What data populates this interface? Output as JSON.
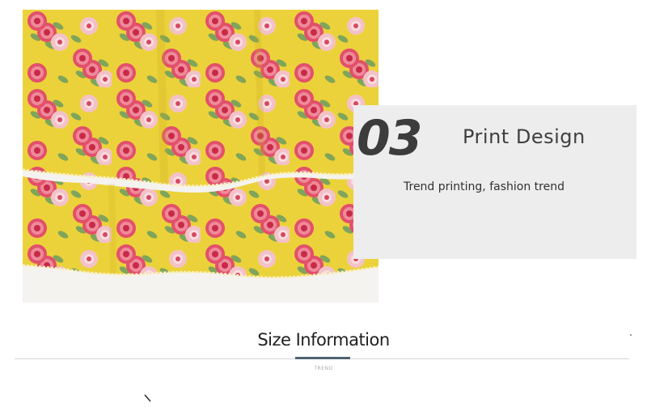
{
  "feature": {
    "number": "03",
    "title": "Print Design",
    "description": "Trend printing, fashion trend"
  },
  "size_section": {
    "title": "Size Information",
    "subtitle": "TREND"
  },
  "colors": {
    "fabric_yellow": "#ecd23a",
    "card_background": "#ededed",
    "accent_bar": "#4f6472"
  }
}
